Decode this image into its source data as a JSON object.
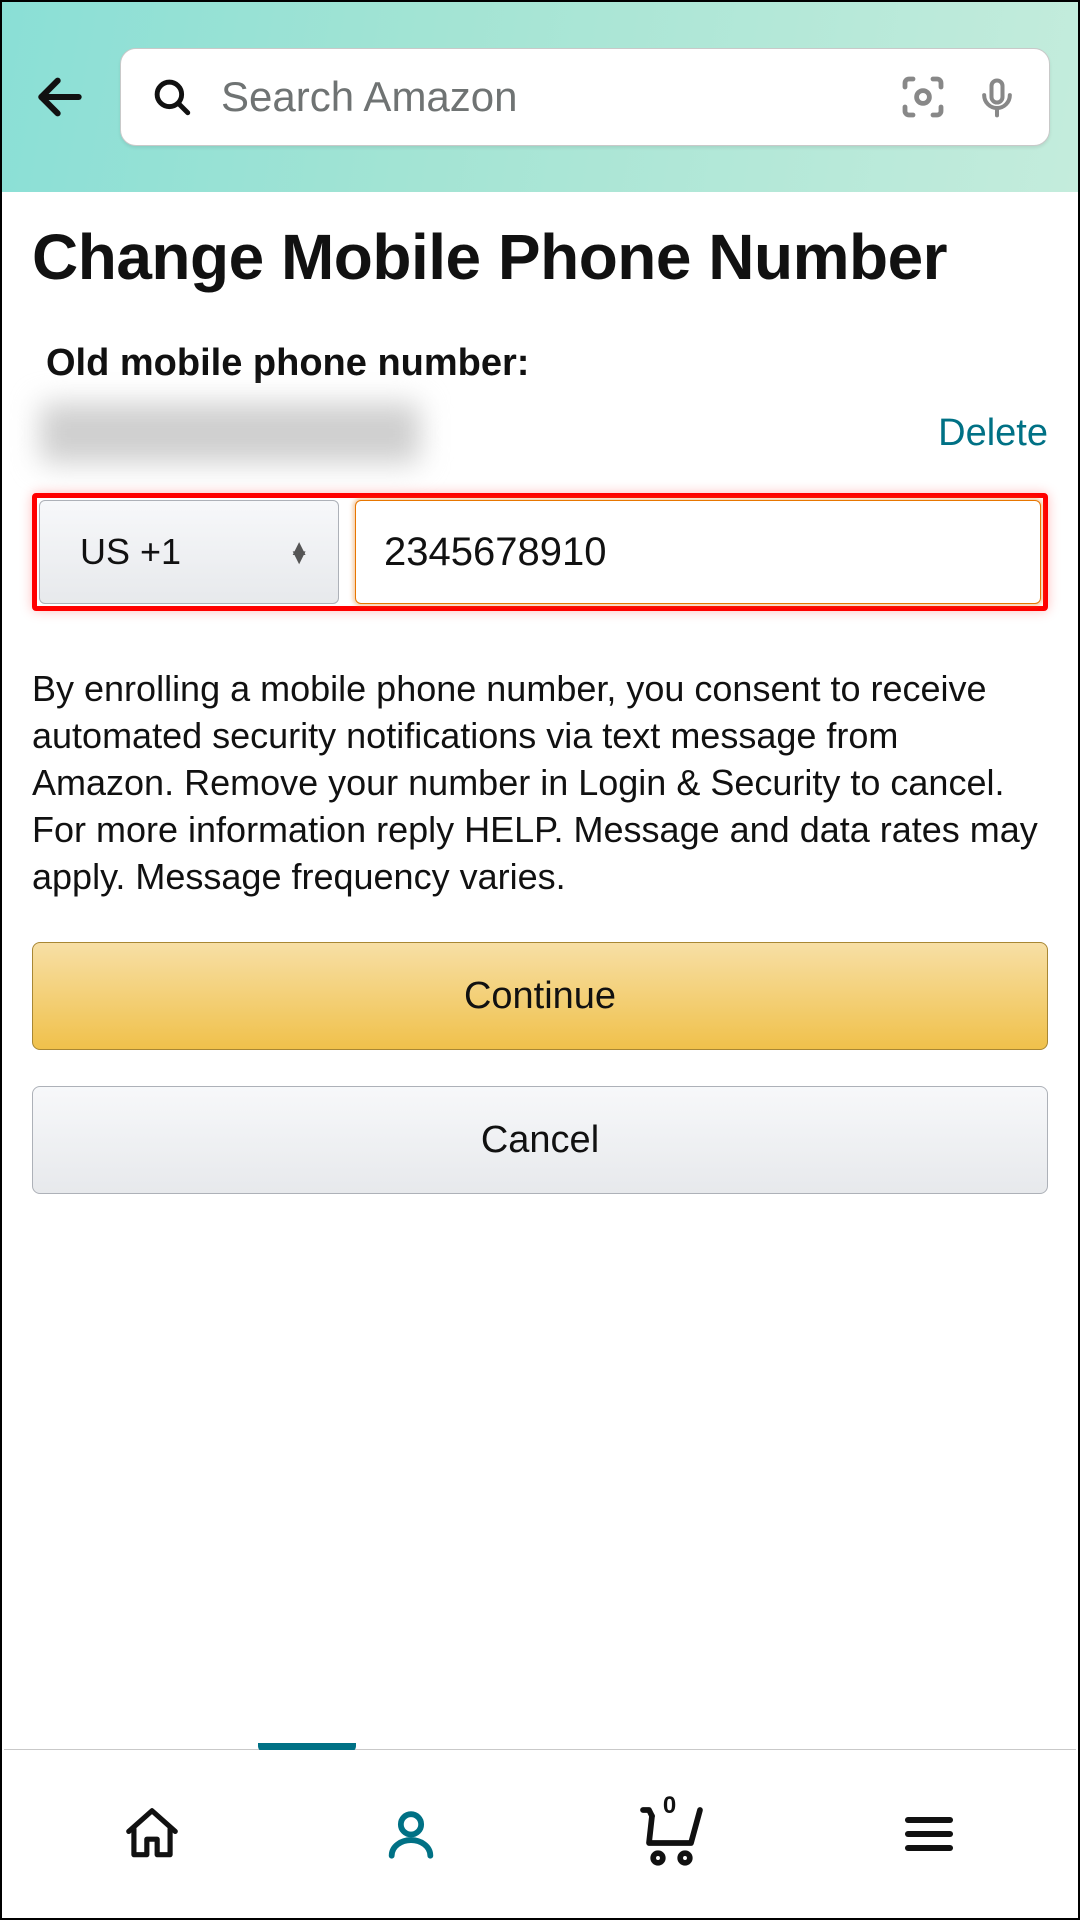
{
  "header": {
    "search_placeholder": "Search Amazon"
  },
  "page": {
    "title": "Change Mobile Phone Number",
    "old_label": "Old mobile phone number:",
    "delete_label": "Delete",
    "country_code": "US +1",
    "phone_value": "2345678910",
    "consent_text": "By enrolling a mobile phone number, you consent to receive automated security notifications via text message from Amazon. Remove your number in Login & Security to cancel. For more information reply HELP. Message and data rates may apply. Message frequency varies.",
    "continue_label": "Continue",
    "cancel_label": "Cancel"
  },
  "nav": {
    "cart_count": "0"
  },
  "colors": {
    "link": "#007185",
    "highlight": "#ff0000",
    "primary_btn": "#f0c14b"
  }
}
